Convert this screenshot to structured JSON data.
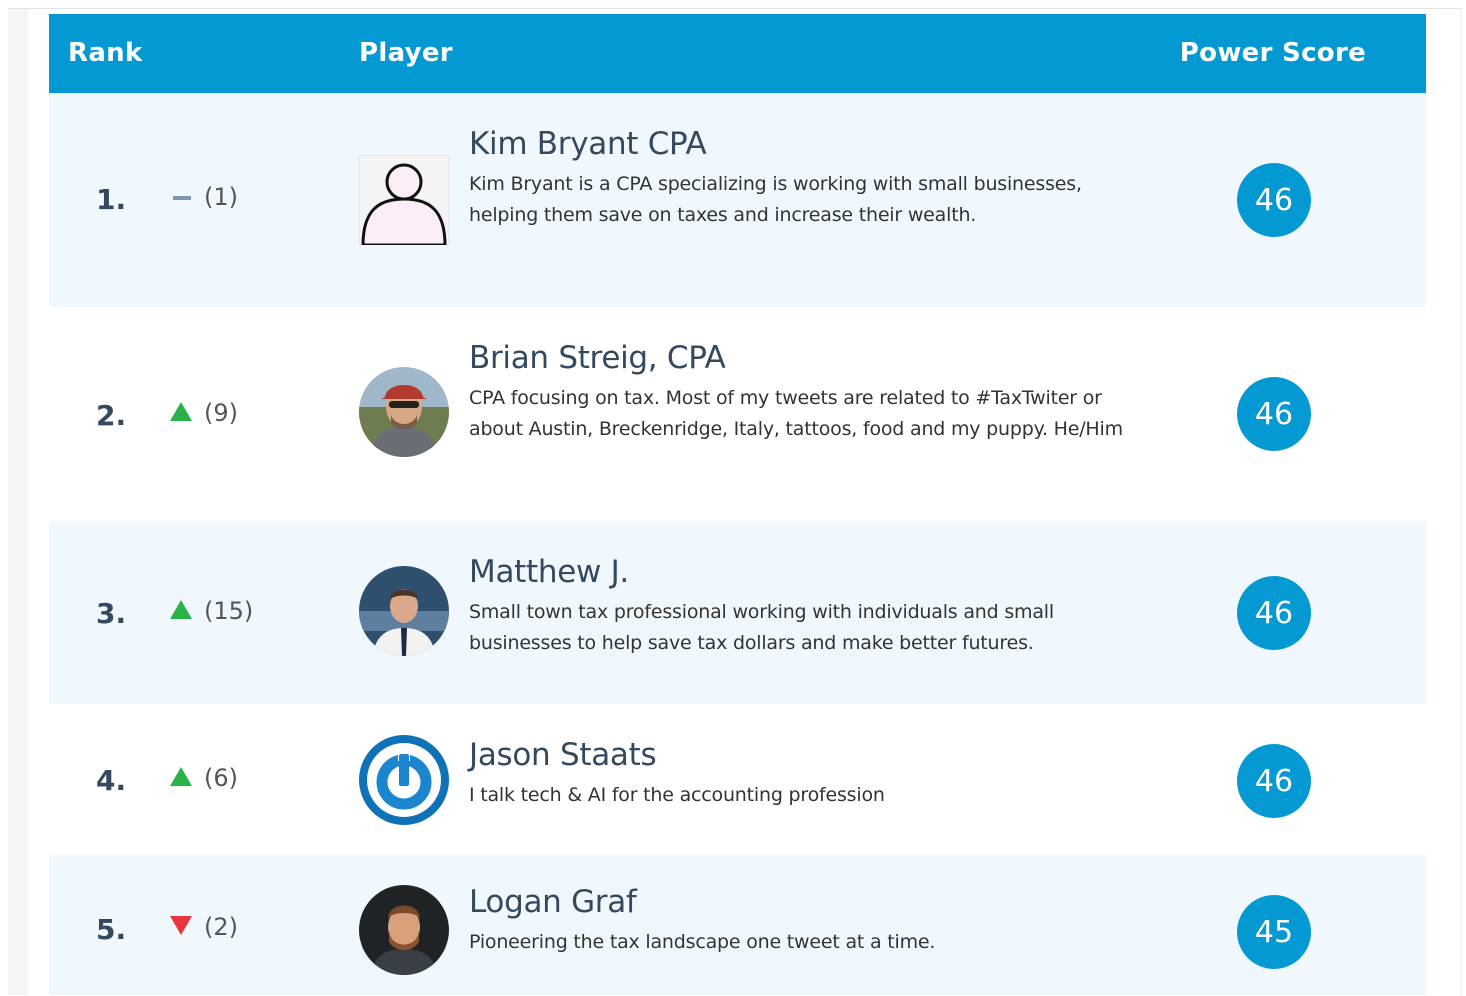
{
  "header": {
    "rank": "Rank",
    "player": "Player",
    "power_score": "Power Score"
  },
  "rows": [
    {
      "rank": "1.",
      "movement": "none",
      "change": "(1)",
      "name": "Kim Bryant CPA",
      "bio": "Kim Bryant is a CPA specializing is working with small businesses, helping them save on taxes and increase their wealth.",
      "score": "46",
      "avatar": "default-user-icon"
    },
    {
      "rank": "2.",
      "movement": "up",
      "change": "(9)",
      "name": "Brian Streig, CPA",
      "bio": "CPA focusing on tax. Most of my tweets are related to #TaxTwiter or about Austin, Breckenridge, Italy, tattoos, food and my puppy. He/Him",
      "score": "46",
      "avatar": "photo"
    },
    {
      "rank": "3.",
      "movement": "up",
      "change": "(15)",
      "name": "Matthew J.",
      "bio": "Small town tax professional working with individuals and small businesses to help save tax dollars and make better futures.",
      "score": "46",
      "avatar": "photo"
    },
    {
      "rank": "4.",
      "movement": "up",
      "change": "(6)",
      "name": "Jason Staats",
      "bio": "I talk tech & AI for the accounting profession",
      "score": "46",
      "avatar": "power-logo-icon"
    },
    {
      "rank": "5.",
      "movement": "down",
      "change": "(2)",
      "name": "Logan Graf",
      "bio": "Pioneering the tax landscape one tweet at a time.",
      "score": "45",
      "avatar": "photo"
    }
  ],
  "colors": {
    "header": "#0599d4",
    "score_badge": "#0599d4",
    "up": "#2ab24a",
    "down": "#e8343f",
    "neutral": "#7f96b0",
    "row_alt": "#f0f8fd"
  }
}
